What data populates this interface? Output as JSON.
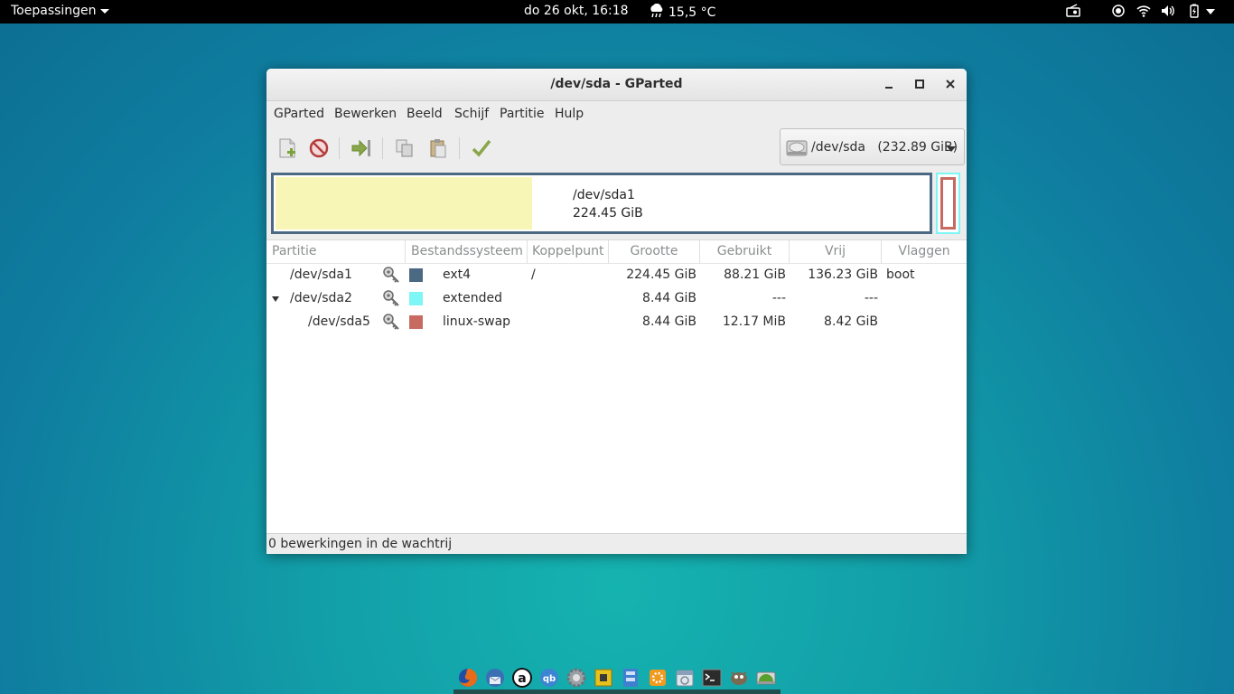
{
  "topbar": {
    "apps_label": "Toepassingen",
    "clock": "do 26 okt, 16:18",
    "weather": "15,5 °C",
    "tray_icons": [
      "radio-icon",
      "location-icon",
      "wifi-icon",
      "volume-icon",
      "battery-icon",
      "power-menu-icon"
    ]
  },
  "window": {
    "title": "/dev/sda - GParted",
    "menu": [
      "GParted",
      "Bewerken",
      "Beeld",
      "Schijf",
      "Partitie",
      "Hulp"
    ],
    "device_selector": {
      "device": "/dev/sda",
      "size": "(232.89 GiB)"
    },
    "disk_map": {
      "sda1_name": "/dev/sda1",
      "sda1_size": "224.45 GiB",
      "sda1_fill_fraction": 0.393
    },
    "columns": [
      "Partitie",
      "Bestandssysteem",
      "Koppelpunt",
      "Grootte",
      "Gebruikt",
      "Vrij",
      "Vlaggen"
    ],
    "rows": [
      {
        "partition": "/dev/sda1",
        "fs": "ext4",
        "fs_color": "#4b6983",
        "mount": "/",
        "size": "224.45 GiB",
        "used": "88.21 GiB",
        "free": "136.23 GiB",
        "flags": "boot"
      },
      {
        "partition": "/dev/sda2",
        "fs": "extended",
        "fs_color": "#7ef6f6",
        "mount": "",
        "size": "8.44 GiB",
        "used": "---",
        "free": "---",
        "flags": ""
      },
      {
        "partition": "/dev/sda5",
        "fs": "linux-swap",
        "fs_color": "#c76a61",
        "mount": "",
        "size": "8.44 GiB",
        "used": "12.17 MiB",
        "free": "8.42 GiB",
        "flags": ""
      }
    ],
    "status": "0 bewerkingen in de wachtrij"
  },
  "dock": {
    "icons": [
      "firefox-icon",
      "thunderbird-icon",
      "amarok-icon",
      "qbittorrent-icon",
      "settings-icon",
      "puzzle-icon",
      "file-cabinet-icon",
      "toolbox-icon",
      "calendar-icon",
      "terminal-icon",
      "gimp-icon",
      "gparted-icon"
    ]
  },
  "colors": {
    "ext4": "#4b6983",
    "extended": "#7ef6f6",
    "linux_swap": "#c76a61",
    "used_space": "#f8f6b6"
  }
}
